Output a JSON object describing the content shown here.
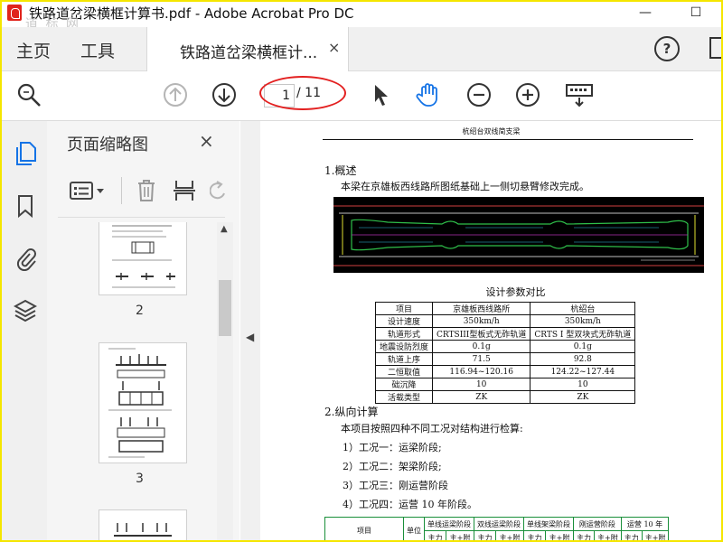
{
  "window": {
    "title": "铁路道岔梁横框计算书.pdf - Adobe Acrobat Pro DC",
    "watermark": "道 标 网",
    "minimize": "—",
    "maximize": "☐"
  },
  "menubar": {
    "home": "主页",
    "tools": "工具",
    "doc_tab": "铁路道岔梁横框计...",
    "doc_tab_close": "×",
    "help": "?"
  },
  "toolbar": {
    "current_page": "1",
    "page_total": "/ 11"
  },
  "panel": {
    "title": "页面缩略图",
    "close": "×",
    "thumbnails": [
      {
        "number": "2"
      },
      {
        "number": "3"
      }
    ]
  },
  "document": {
    "header": "杭绍台双线简支梁",
    "section1": {
      "heading": "1.概述",
      "text": "本梁在京雄板西线路所图纸基础上一侧切悬臂修改完成。"
    },
    "table_title": "设计参数对比",
    "params_table": {
      "header": [
        "项目",
        "京雄板西线路所",
        "杭绍台"
      ],
      "rows": [
        [
          "设计速度",
          "350km/h",
          "350km/h"
        ],
        [
          "轨道形式",
          "CRTSIII型板式无砟轨道",
          "CRTS I 型双块式无砟轨道"
        ],
        [
          "地震设防烈度",
          "0.1g",
          "0.1g"
        ],
        [
          "轨道上序",
          "71.5",
          "92.8"
        ],
        [
          "二恒取值",
          "116.94~120.16",
          "124.22~127.44"
        ],
        [
          "础沉降",
          "10",
          "10"
        ],
        [
          "活载类型",
          "ZK",
          "ZK"
        ]
      ]
    },
    "section2": {
      "heading": "2.纵向计算",
      "intro": "本项目按照四种不同工况对结构进行检算:",
      "items": [
        "1）工况一：运梁阶段;",
        "2）工况二：架梁阶段;",
        "3）工况三：刚运营阶段",
        "4）工况四：运营 10 年阶段。"
      ]
    },
    "cases_table": {
      "col_item": "项目",
      "col_unit": "单位",
      "groups": [
        "单线运梁阶段",
        "双线运梁阶段",
        "单线架梁阶段",
        "刚运营阶段",
        "运营 10 年"
      ],
      "sub": [
        "主力",
        "主+附"
      ]
    }
  },
  "colors": {
    "accent": "#1473e6",
    "annotation": "#e32020",
    "table_green": "#1a8f3a",
    "highlight_border": "#f5e600"
  }
}
